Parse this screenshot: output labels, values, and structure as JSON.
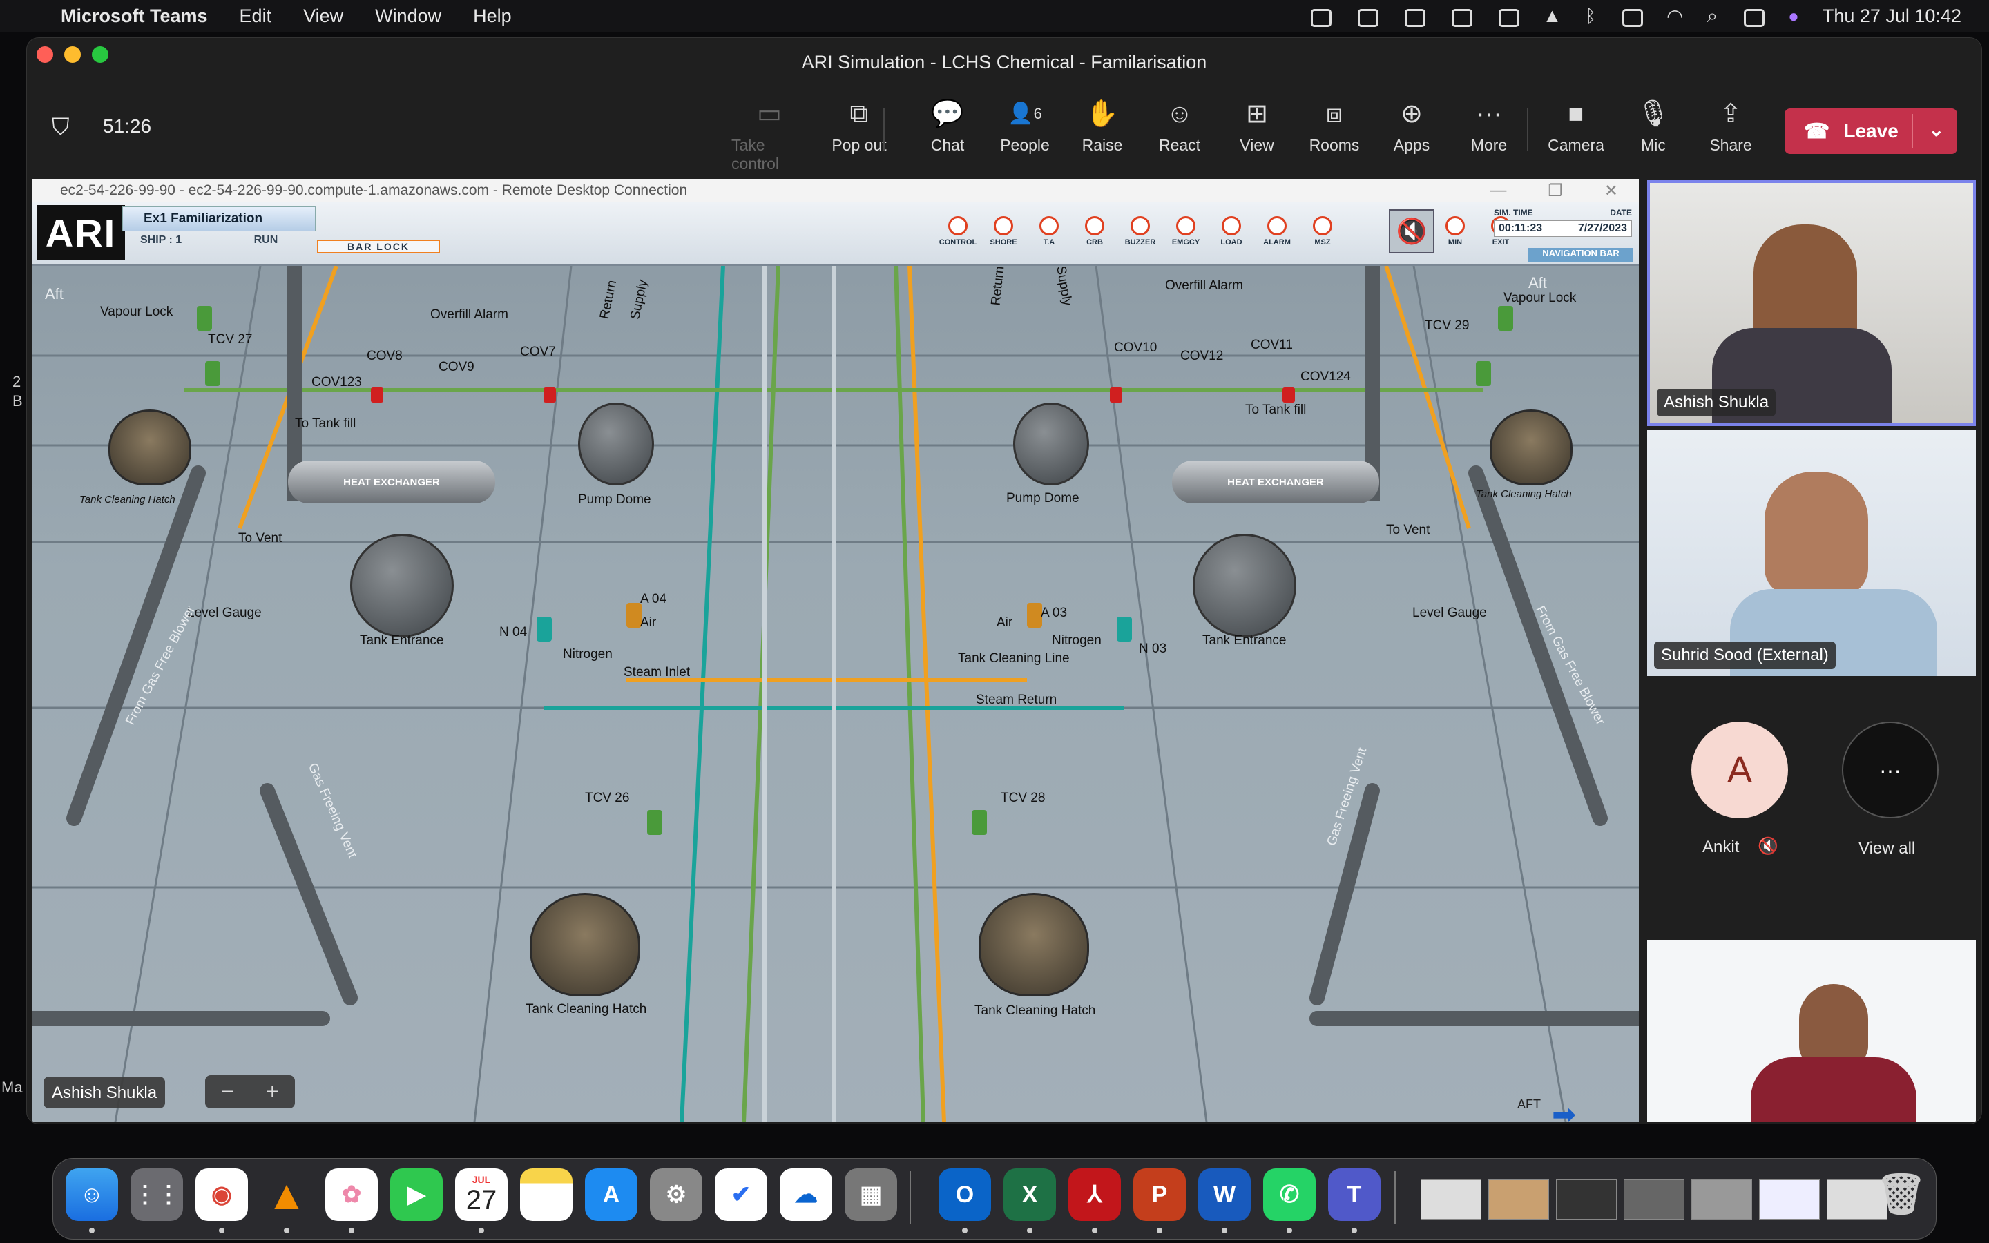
{
  "menubar": {
    "app_name": "Microsoft Teams",
    "items": [
      "Edit",
      "View",
      "Window",
      "Help"
    ],
    "clock": "Thu 27 Jul  10:42"
  },
  "window": {
    "title": "ARI Simulation - LCHS Chemical - Familarisation"
  },
  "meeting": {
    "timer": "51:26",
    "toolbar": {
      "take_control": "Take control",
      "pop_out": "Pop out",
      "chat": "Chat",
      "people": "People",
      "people_count": "6",
      "raise": "Raise",
      "react": "React",
      "view": "View",
      "rooms": "Rooms",
      "apps": "Apps",
      "more": "More",
      "camera": "Camera",
      "mic": "Mic",
      "share": "Share",
      "leave": "Leave"
    },
    "presenter_chip": "Ashish Shukla"
  },
  "rdp": {
    "title": "ec2-54-226-99-90 - ec2-54-226-99-90.compute-1.amazonaws.com - Remote Desktop Connection"
  },
  "sim": {
    "logo": "ARI",
    "exercise": "Ex1 Familiarization",
    "ship": "SHIP : 1",
    "mode": "RUN",
    "bar_lock": "BAR LOCK",
    "controls": [
      "CONTROL",
      "SHORE",
      "T.A",
      "CRB",
      "BUZZER",
      "EMGCY",
      "LOAD",
      "ALARM",
      "MSZ",
      "MIN",
      "EXIT"
    ],
    "sim_time_label": "SIM. TIME",
    "date_label": "DATE",
    "sim_time": "00:11:23",
    "date": "7/27/2023",
    "navigation_bar": "NAVIGATION BAR",
    "labels": {
      "aft_left": "Aft",
      "aft_right": "Aft",
      "vapour_lock_l": "Vapour Lock",
      "vapour_lock_r": "Vapour Lock",
      "tcv27": "TCV 27",
      "tcv29": "TCV 29",
      "overfill_l": "Overfill Alarm",
      "overfill_r": "Overfill Alarm",
      "return_l": "Return",
      "supply_l": "Supply",
      "return_r": "Return",
      "supply_r": "Supply",
      "cov8": "COV8",
      "cov9": "COV9",
      "cov7": "COV7",
      "cov10": "COV10",
      "cov12": "COV12",
      "cov11": "COV11",
      "cov123": "COV123",
      "cov124": "COV124",
      "to_tank_fill_l": "To Tank fill",
      "to_tank_fill_r": "To Tank fill",
      "heat_exchanger_l": "HEAT EXCHANGER",
      "heat_exchanger_r": "HEAT EXCHANGER",
      "pump_dome_l": "Pump Dome",
      "pump_dome_r": "Pump Dome",
      "tank_cleaning_hatch_l": "Tank Cleaning Hatch",
      "tank_cleaning_hatch_r": "Tank Cleaning Hatch",
      "to_vent_l": "To Vent",
      "to_vent_r": "To Vent",
      "level_gauge_l": "Level Gauge",
      "level_gauge_r": "Level Gauge",
      "tank_entrance_l": "Tank Entrance",
      "tank_entrance_r": "Tank Entrance",
      "a04": "A 04",
      "a03": "A 03",
      "air_l": "Air",
      "air_r": "Air",
      "n04": "N 04",
      "n03": "N 03",
      "nitrogen_l": "Nitrogen",
      "nitrogen_r": "Nitrogen",
      "steam_inlet": "Steam Inlet",
      "tank_cleaning_line": "Tank Cleaning Line",
      "steam_return": "Steam Return",
      "from_gas_free_blower_l": "From Gas Free Blower",
      "from_gas_free_blower_r": "From Gas Free Blower",
      "gas_freeing_vent_l": "Gas Freeing Vent",
      "gas_freeing_vent_r": "Gas Freeing Vent",
      "tcv26": "TCV 26",
      "tcv28": "TCV 28",
      "bottom_hatch_l": "Tank Cleaning Hatch",
      "bottom_hatch_r": "Tank Cleaning Hatch",
      "aft_nav": "AFT"
    }
  },
  "participants": [
    {
      "name": "Ashish Shukla"
    },
    {
      "name": "Suhrid Sood (External)"
    },
    {
      "name": "Ankit",
      "initial": "A"
    },
    {
      "name": "View all"
    }
  ],
  "side_markers": {
    "a": "2",
    "b": "B",
    "c": "Ma"
  },
  "dock": {
    "calendar_month": "JUL",
    "calendar_day": "27"
  },
  "colors": {
    "leave": "#c4314b",
    "accent": "#7b83eb"
  }
}
